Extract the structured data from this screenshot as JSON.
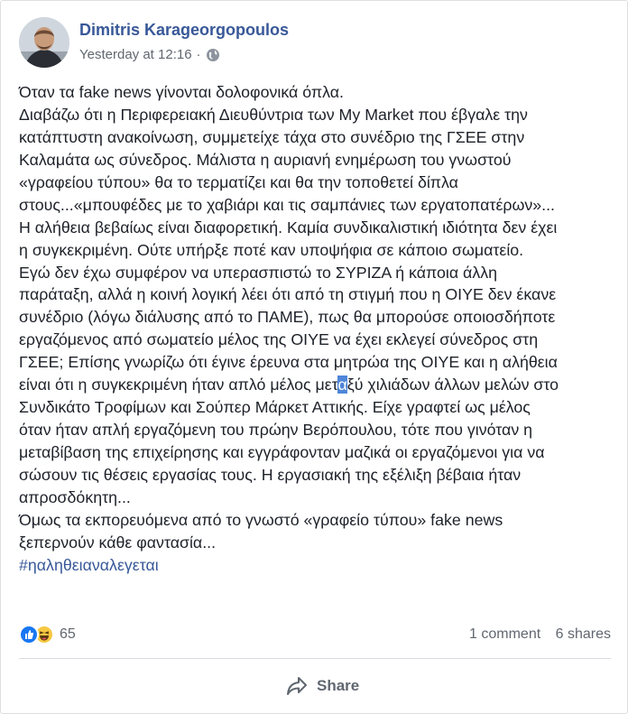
{
  "post": {
    "author": "Dimitris Karageorgopoulos",
    "timestamp": "Yesterday at 12:16",
    "separator": "·",
    "privacy_icon": "globe-icon",
    "lines": [
      "Όταν τα fake news γίνονται δολοφονικά όπλα.",
      "Διαβάζω ότι η Περιφερειακή Διευθύντρια των My Market που έβγαλε την",
      "κατάπτυστη ανακοίνωση, συμμετείχε τάχα στο συνέδριο της ΓΣΕΕ στην",
      "Καλαμάτα ως σύνεδρος. Μάλιστα η αυριανή ενημέρωση του γνωστού",
      "«γραφείου τύπου» θα το τερματίζει και θα την τοποθετεί δίπλα",
      "στους...«μπουφέδες με το χαβιάρι και τις σαμπάνιες των εργατοπατέρων»...",
      "Η αλήθεια βεβαίως είναι διαφορετική. Καμία συνδικαλιστική ιδιότητα δεν έχει",
      "η συγκεκριμένη. Ούτε υπήρξε ποτέ καν υποψήφια σε κάποιο σωματείο.",
      "Εγώ δεν έχω συμφέρον να υπερασπιστώ το ΣΥΡΙΖΑ ή κάποια άλλη",
      "παράταξη, αλλά η κοινή λογική λέει ότι από τη στιγμή που η ΟΙΥΕ δεν έκανε",
      "συνέδριο (λόγω διάλυσης από το ΠΑΜΕ), πως θα μπορούσε οποιοσδήποτε",
      "εργαζόμενος από σωματείο μέλος της ΟΙΥΕ να έχει εκλεγεί σύνεδρος στη",
      "ΓΣΕΕ; Επίσης γνωρίζω ότι έγινε έρευνα στα μητρώα της ΟΙΥΕ και η αλήθεια"
    ],
    "selected_line": {
      "before": "είναι ότι η συγκεκριμένη ήταν απλό μέλος μετ",
      "selected": "α",
      "after": "ξύ χιλιάδων άλλων μελών στο"
    },
    "lines_after": [
      "Συνδικάτο Τροφίμων και Σούπερ Μάρκετ Αττικής. Είχε γραφτεί ως μέλος",
      "όταν ήταν απλή εργαζόμενη του πρώην Βερόπουλου, τότε που γινόταν η",
      "μεταβίβαση της επιχείρησης και εγγράφονταν μαζικά οι εργαζόμενοι για να",
      "σώσουν τις θέσεις εργασίας τους. Η εργασιακή της εξέλιξη βέβαια ήταν",
      "απροσδόκητη...",
      "Όμως τα εκπορευόμενα από το γνωστό «γραφείο τύπου» fake news",
      "ξεπερνούν κάθε φαντασία..."
    ],
    "hashtag": "#ηαληθειαναλεγεται"
  },
  "stats": {
    "reaction_icons": [
      "like-icon",
      "haha-icon"
    ],
    "reaction_count": "65",
    "comments": "1 comment",
    "shares": "6 shares"
  },
  "actions": {
    "share_label": "Share",
    "share_icon": "share-arrow-icon"
  },
  "colors": {
    "link": "#385898",
    "meta": "#616770",
    "like": "#1877f2",
    "haha": "#f7c841"
  }
}
